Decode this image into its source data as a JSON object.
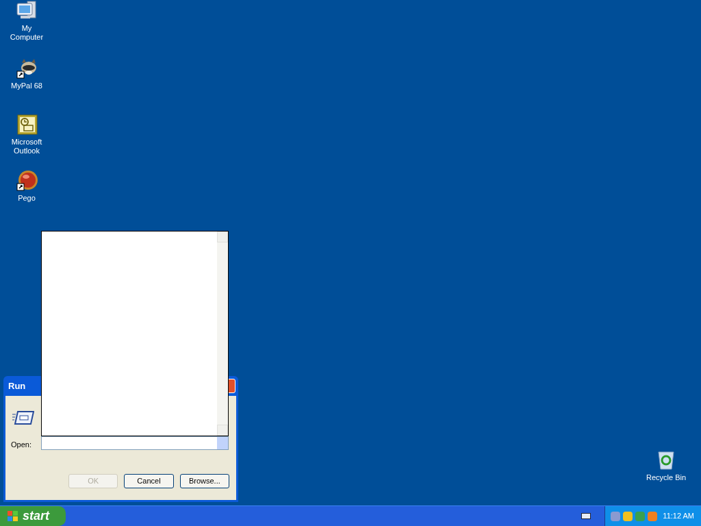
{
  "desktop_icons": [
    {
      "label": "My Computer",
      "kind": "computer"
    },
    {
      "label": "MyPal 68",
      "kind": "raccoon"
    },
    {
      "label": "Microsoft Outlook",
      "kind": "outlook"
    },
    {
      "label": "Pego",
      "kind": "ball"
    },
    {
      "label": "Recycle Bin",
      "kind": "bin"
    }
  ],
  "dialog": {
    "title": "Run",
    "open_label": "Open:",
    "dropdown_expanded": true,
    "buttons": [
      {
        "label": "OK",
        "disabled": true
      },
      {
        "label": "Cancel",
        "disabled": false
      },
      {
        "label": "Browse...",
        "disabled": false
      }
    ]
  },
  "taskbar": {
    "start": "start",
    "clock": "11:12 AM"
  }
}
